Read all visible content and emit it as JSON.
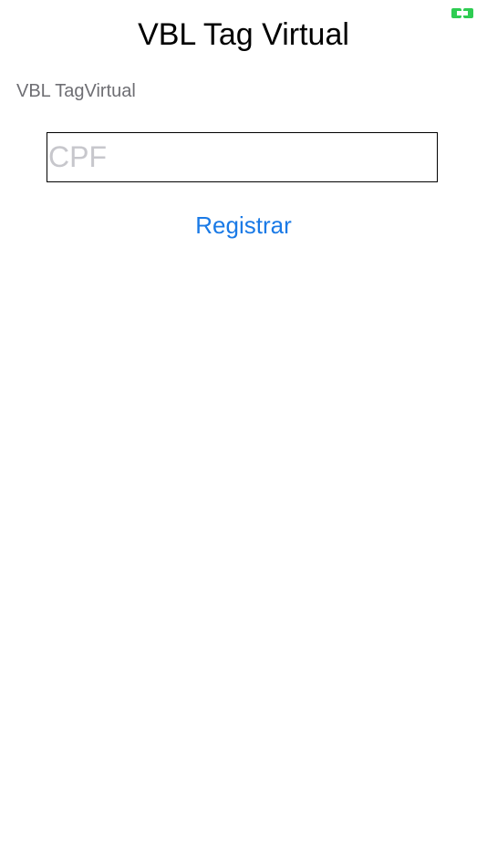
{
  "header": {
    "title": "VBL Tag Virtual",
    "status_icon": "green-bracket-indicator-icon",
    "status_color": "#2ecc52"
  },
  "main": {
    "subtitle": "VBL TagVirtual",
    "cpf_input": {
      "value": "",
      "placeholder": "CPF"
    },
    "register_label": "Registrar"
  },
  "colors": {
    "accent": "#1a7ae6",
    "placeholder": "#c7c7cc",
    "subtitle": "#6e6e73"
  }
}
